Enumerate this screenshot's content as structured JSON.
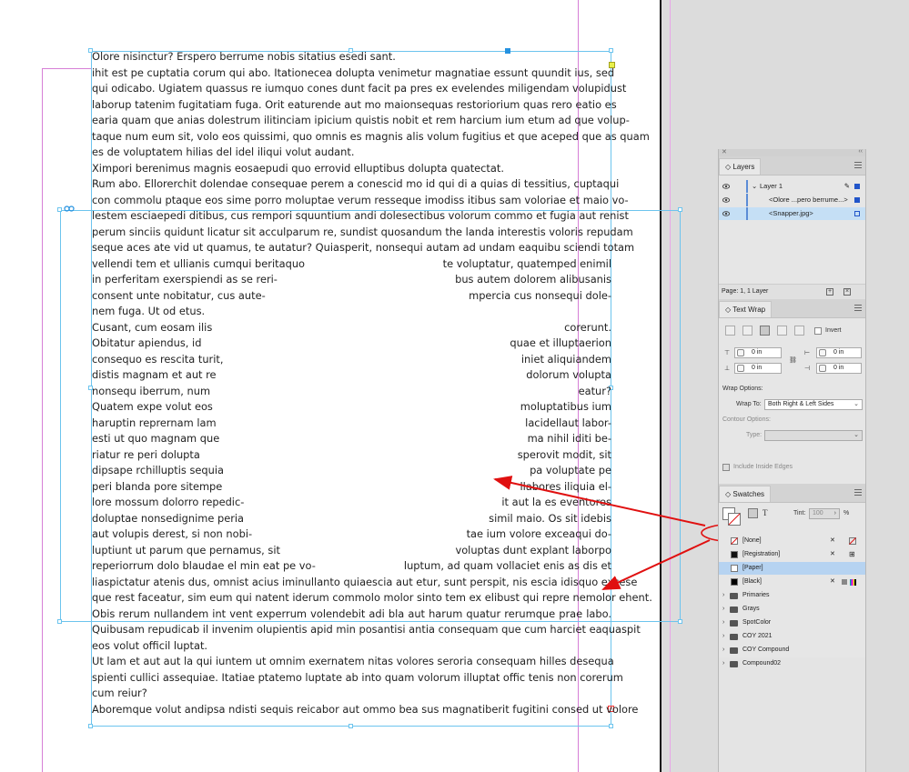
{
  "document": {
    "text_lines": [
      {
        "text": "Olore nisinctur? Erspero berrume nobis sitatius esedi sant."
      },
      {
        "text": "ihit est pe cuptatia corum qui abo. Itationecea dolupta venimetur magnatiae essunt quundit ius, sed"
      },
      {
        "text": "qui odicabo. Ugiatem quassus re iumquo cones dunt facit pa pres ex evelendes miligendam volupidust"
      },
      {
        "text": "laborup tatenim fugitatiam fuga. Orit eaturende aut mo maionsequas restoriorium quas rero eatio es"
      },
      {
        "text": "earia quam que anias dolestrum ilitinciam ipicium quistis nobit et rem harcium ium etum ad que volup-"
      },
      {
        "text": "taque num eum sit, volo eos quissimi, quo omnis es magnis alis volum fugitius et que aceped que as quam"
      },
      {
        "text": "es de voluptatem hilias del idel iliqui volut audant."
      },
      {
        "text": "Ximpori berenimus magnis eosaepudi quo errovid elluptibus dolupta quatectat."
      },
      {
        "text": "Rum abo. Ellorerchit dolendae consequae perem a conescid mo id qui di a quias di tessitius, cuptaqui"
      },
      {
        "text": "con commolu ptaque eos sime porro moluptae verum resseque imodiss itibus sam voloriae et maio vo-"
      },
      {
        "text": "lestem esciaepedi ditibus, cus rempori squuntium andi dolesectibus volorum commo et fugia aut renist"
      },
      {
        "text": "perum sinciis quidunt licatur sit acculparum re, sundist quosandum the landa interestis voloris repudam"
      },
      {
        "text": "seque aces ate vid ut quamus, te autatur? Quiasperit, nonsequi autam ad undam eaquibu sciendi totam"
      }
    ],
    "split_lines": [
      {
        "left": "vellendi tem et ullianis cumqui beritaquo",
        "right": "te voluptatur, quatemped enimil"
      },
      {
        "left": "in perferitam exerspiendi as se reri-",
        "right": "bus autem dolorem alibusanis"
      },
      {
        "left": "consent unte nobitatur, cus aute-",
        "right": "mpercia cus nonsequi dole-"
      },
      {
        "left": "nem fuga. Ut od etus.",
        "right": ""
      },
      {
        "left": "Cusant, cum eosam ilis",
        "right": "corerunt."
      },
      {
        "left": "Obitatur apiendus, id",
        "right": "quae et illuptaerion"
      },
      {
        "left": "consequo es rescita turit,",
        "right": "iniet aliquiandem"
      },
      {
        "left": "distis magnam et aut re",
        "right": "dolorum volupta"
      },
      {
        "left": "nonsequ iberrum, num",
        "right": "eatur?"
      },
      {
        "left": "Quatem expe volut eos",
        "right": "moluptatibus ium"
      },
      {
        "left": "haruptin reprernam lam",
        "right": "lacidellaut labor-"
      },
      {
        "left": "esti ut quo magnam que",
        "right": "ma nihil iditi be-"
      },
      {
        "left": "riatur re peri dolupta",
        "right": "sperovit modit, sit"
      },
      {
        "left": "dipsape rchilluptis sequia",
        "right": "pa voluptate pe"
      },
      {
        "left": "peri blanda pore sitempe",
        "right": "llabores iliquia el-"
      },
      {
        "left": "lore mossum dolorro repedic-",
        "right": "it aut la es eventores"
      },
      {
        "left": "doluptae nonsedignime peria",
        "right": "simil maio. Os sit idebis"
      },
      {
        "left": "aut volupis derest, si non nobi-",
        "right": "tae ium volore exceaqui do-"
      },
      {
        "left": "luptiunt ut parum que pernamus, sit",
        "right": "voluptas dunt explant laborpo"
      },
      {
        "left": "reperiorrum dolo blaudae el min eat pe vo-",
        "right": "luptum, ad quam vollaciet enis as dis et"
      }
    ],
    "bottom_lines": [
      {
        "text": "liaspictatur atenis dus, omnist acius iminullanto quiaescia aut etur, sunt perspit, nis escia idisquo excese"
      },
      {
        "text": "que rest faceatur, sim eum qui natent iderum commolo molor sinto tem ex elibust qui repre nemolor ehent."
      },
      {
        "text": "Obis rerum nullandem int vent experrum volendebit adi bla aut harum quatur rerumque prae labo."
      },
      {
        "text": "Quibusam repudicab il invenim olupientis apid min posantisi antia consequam que cum harciet eaquaspit"
      },
      {
        "text": "eos volut officil luptat."
      },
      {
        "text": "Ut lam et aut aut la qui iuntem ut omnim exernatem nitas volores seroria consequam hilles desequa"
      },
      {
        "text": "spienti cullici assequiae. Itatiae ptatemo luptate ab into quam volorum illuptat offic tenis non corerum"
      },
      {
        "text": "cum reiur?"
      },
      {
        "text": "Aboremque volut andipsa ndisti sequis reicabor aut ommo bea sus magnatiberit fugitini consed ut volore"
      }
    ]
  },
  "layers_panel": {
    "tab": "Layers",
    "rows": [
      {
        "label": "Layer 1"
      },
      {
        "label": "<Olore ...pero berrume...>"
      },
      {
        "label": "<Snapper.jpg>"
      }
    ],
    "footer": "Page: 1, 1 Layer"
  },
  "text_wrap_panel": {
    "tab": "Text Wrap",
    "invert_label": "Invert",
    "top_offset": "0 in",
    "bottom_offset": "0 in",
    "left_offset": "0 in",
    "right_offset": "0 in",
    "wrap_options_label": "Wrap Options:",
    "wrap_to_label": "Wrap To:",
    "wrap_to_value": "Both Right & Left Sides",
    "contour_options_label": "Contour Options:",
    "type_label": "Type:",
    "include_inside_edges_label": "Include Inside Edges"
  },
  "swatches_panel": {
    "tab": "Swatches",
    "tint_label": "Tint:",
    "tint_value": "100",
    "tint_unit": "%",
    "rows": [
      {
        "name": "[None]",
        "kind": "none"
      },
      {
        "name": "[Registration]",
        "kind": "registration"
      },
      {
        "name": "[Paper]",
        "kind": "paper"
      },
      {
        "name": "[Black]",
        "kind": "black"
      }
    ],
    "folders": [
      "Primaries",
      "Grays",
      "SpotColor",
      "COY 2021",
      "COY Compound",
      "Compound02"
    ]
  },
  "colors": {
    "frame": "#6cc4ee",
    "guide": "#d67fd6",
    "annotation_red": "#e01010",
    "selection": "#b6d3f1"
  }
}
